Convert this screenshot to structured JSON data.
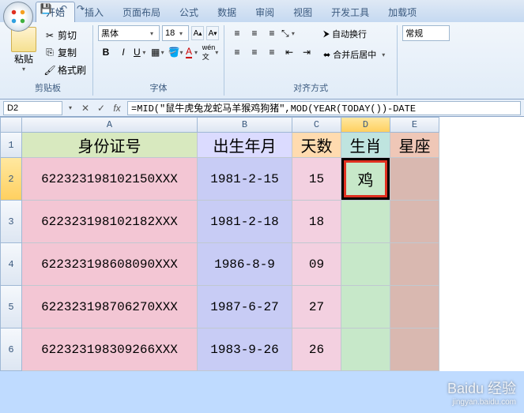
{
  "tabs": [
    "开始",
    "插入",
    "页面布局",
    "公式",
    "数据",
    "审阅",
    "视图",
    "开发工具",
    "加载项"
  ],
  "clipboard": {
    "paste": "粘贴",
    "cut": "剪切",
    "copy": "复制",
    "painter": "格式刷",
    "label": "剪贴板"
  },
  "font": {
    "name": "黑体",
    "size": "18",
    "label": "字体"
  },
  "align": {
    "wrap": "自动换行",
    "merge": "合并后居中",
    "label": "对齐方式"
  },
  "number": {
    "format": "常规"
  },
  "name_box": "D2",
  "formula": "=MID(\"鼠牛虎兔龙蛇马羊猴鸡狗猪\",MOD(YEAR(TODAY())-DATE",
  "cols": [
    "A",
    "B",
    "C",
    "D",
    "E"
  ],
  "headers": {
    "A": "身份证号",
    "B": "出生年月",
    "C": "天数",
    "D": "生肖",
    "E": "星座"
  },
  "chart_data": {
    "type": "table",
    "columns": [
      "身份证号",
      "出生年月",
      "天数",
      "生肖",
      "星座"
    ],
    "rows": [
      {
        "A": "622323198102150XXX",
        "B": "1981-2-15",
        "C": "15",
        "D": "鸡",
        "E": ""
      },
      {
        "A": "622323198102182XXX",
        "B": "1981-2-18",
        "C": "18",
        "D": "",
        "E": ""
      },
      {
        "A": "622323198608090XXX",
        "B": "1986-8-9",
        "C": "09",
        "D": "",
        "E": ""
      },
      {
        "A": "622323198706270XXX",
        "B": "1987-6-27",
        "C": "27",
        "D": "",
        "E": ""
      },
      {
        "A": "622323198309266XXX",
        "B": "1983-9-26",
        "C": "26",
        "D": "",
        "E": ""
      }
    ]
  },
  "watermark": {
    "brand": "Baidu 经验",
    "url": "jingyan.baidu.com"
  }
}
